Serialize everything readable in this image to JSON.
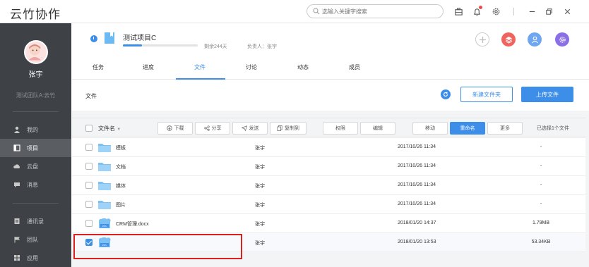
{
  "app": {
    "title": "云竹协作",
    "search_placeholder": "选输入关键字搜索"
  },
  "colors": {
    "accent": "#3c8ee8",
    "sidebar": "#3e4247",
    "highlight": "#d9221d"
  },
  "sidebar": {
    "user_name": "张宇",
    "team": "测试团队A:云竹",
    "items": [
      {
        "label": "我的",
        "icon": "person-icon"
      },
      {
        "label": "项目",
        "icon": "project-icon",
        "active": true
      },
      {
        "label": "云盘",
        "icon": "cloud-icon"
      },
      {
        "label": "消息",
        "icon": "message-icon"
      },
      {
        "label": "通讯录",
        "icon": "contacts-icon"
      },
      {
        "label": "团队",
        "icon": "flag-icon"
      },
      {
        "label": "应用",
        "icon": "apps-icon"
      }
    ]
  },
  "project": {
    "title": "测试项目C",
    "progress": 0.25,
    "remaining": "剩余244天",
    "owner": "负责人：张宇"
  },
  "tabs": [
    {
      "label": "任务"
    },
    {
      "label": "进度"
    },
    {
      "label": "文件",
      "active": true
    },
    {
      "label": "讨论"
    },
    {
      "label": "动态"
    },
    {
      "label": "成员"
    }
  ],
  "files_toolbar": {
    "crumb": "文件",
    "new_folder": "新建文件夹",
    "upload": "上传文件"
  },
  "table": {
    "name_header": "文件名",
    "actions": {
      "download": "下载",
      "share": "分享",
      "send": "发送",
      "copy_to": "复制到",
      "permission": "权限",
      "edit": "编辑",
      "move": "移动",
      "rename": "重命名",
      "more": "更多"
    },
    "selected_count": "已选择1个文件",
    "rows": [
      {
        "name": "模板",
        "owner": "张宇",
        "time": "2017/10/26 11:34",
        "size": "-",
        "type": "folder"
      },
      {
        "name": "文档",
        "owner": "张宇",
        "time": "2017/10/26 11:34",
        "size": "-",
        "type": "folder"
      },
      {
        "name": "媒体",
        "owner": "张宇",
        "time": "2017/10/26 11:34",
        "size": "-",
        "type": "folder"
      },
      {
        "name": "图片",
        "owner": "张宇",
        "time": "2017/10/26 11:34",
        "size": "-",
        "type": "folder"
      },
      {
        "name": "CRM管理.docx",
        "owner": "张宇",
        "time": "2018/01/20 14:37",
        "size": "1.79MB",
        "type": "docx"
      },
      {
        "name": "",
        "owner": "张宇",
        "time": "2018/01/20 13:53",
        "size": "53.34KB",
        "type": "docx",
        "checked": true
      }
    ]
  }
}
